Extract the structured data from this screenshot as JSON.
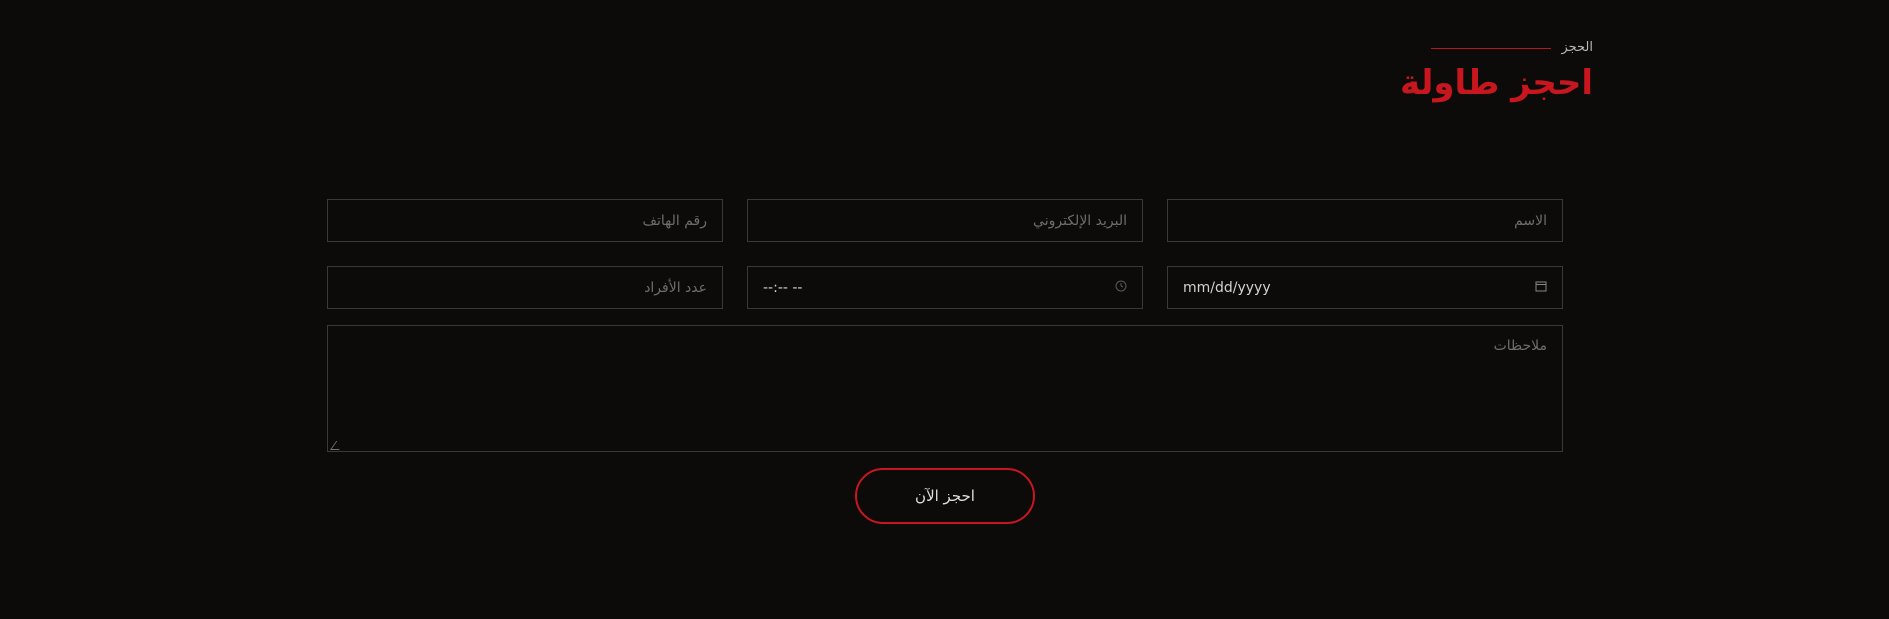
{
  "header": {
    "eyebrow": "الحجز",
    "title": "احجز طاولة"
  },
  "form": {
    "name_placeholder": "الاسم",
    "email_placeholder": "البريد الإلكتروني",
    "phone_placeholder": "رقم الهاتف",
    "date_value": "mm/dd/yyyy",
    "time_value": "--:-- --",
    "guests_placeholder": "عدد الأفراد",
    "notes_placeholder": "ملاحظات",
    "submit_label": "احجز الآن"
  },
  "icons": {
    "calendar": "calendar-icon",
    "clock": "clock-icon"
  },
  "colors": {
    "background": "#0c0b09",
    "accent": "#c8161e",
    "border": "#3a3936",
    "placeholder": "#6f6d6a",
    "text": "#cfcdca"
  }
}
